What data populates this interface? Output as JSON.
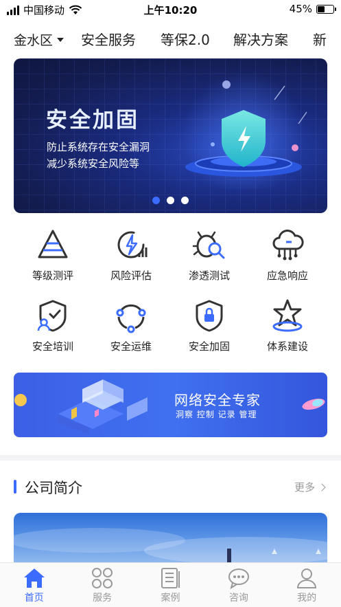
{
  "status_bar": {
    "carrier": "中国移动",
    "time": "上午10:20",
    "battery_percent": "45%",
    "battery_level": 0.45
  },
  "top_nav": {
    "region": "金水区",
    "items": [
      "安全服务",
      "等保2.0",
      "解决方案",
      "新"
    ]
  },
  "banner": {
    "title": "安全加固",
    "line1": "防止系统存在安全漏洞",
    "line2": "减少系统安全风险等",
    "slide_count": 3,
    "active_slide": 1
  },
  "services": [
    {
      "label": "等级测评",
      "icon": "pyramid-icon"
    },
    {
      "label": "风险评估",
      "icon": "lightning-chart-icon"
    },
    {
      "label": "渗透测试",
      "icon": "bug-search-icon"
    },
    {
      "label": "应急响应",
      "icon": "cloud-network-icon"
    },
    {
      "label": "安全培训",
      "icon": "shield-user-icon"
    },
    {
      "label": "安全运维",
      "icon": "cycle-nodes-icon"
    },
    {
      "label": "安全加固",
      "icon": "shield-lock-icon"
    },
    {
      "label": "体系建设",
      "icon": "star-platform-icon"
    }
  ],
  "promo": {
    "title": "网络安全专家",
    "subtitle": "洞察 控制 记录 管理"
  },
  "company": {
    "title": "公司简介",
    "more": "更多"
  },
  "tab_bar": {
    "tabs": [
      {
        "label": "首页",
        "icon": "home-icon",
        "active": true
      },
      {
        "label": "服务",
        "icon": "grid-icon",
        "active": false
      },
      {
        "label": "案例",
        "icon": "document-icon",
        "active": false
      },
      {
        "label": "咨询",
        "icon": "chat-icon",
        "active": false
      },
      {
        "label": "我的",
        "icon": "user-icon",
        "active": false
      }
    ]
  },
  "colors": {
    "accent": "#3b6cff",
    "banner_bg": "#131c4e",
    "promo_bg": "#4070f0",
    "inactive_tab": "#999999"
  }
}
